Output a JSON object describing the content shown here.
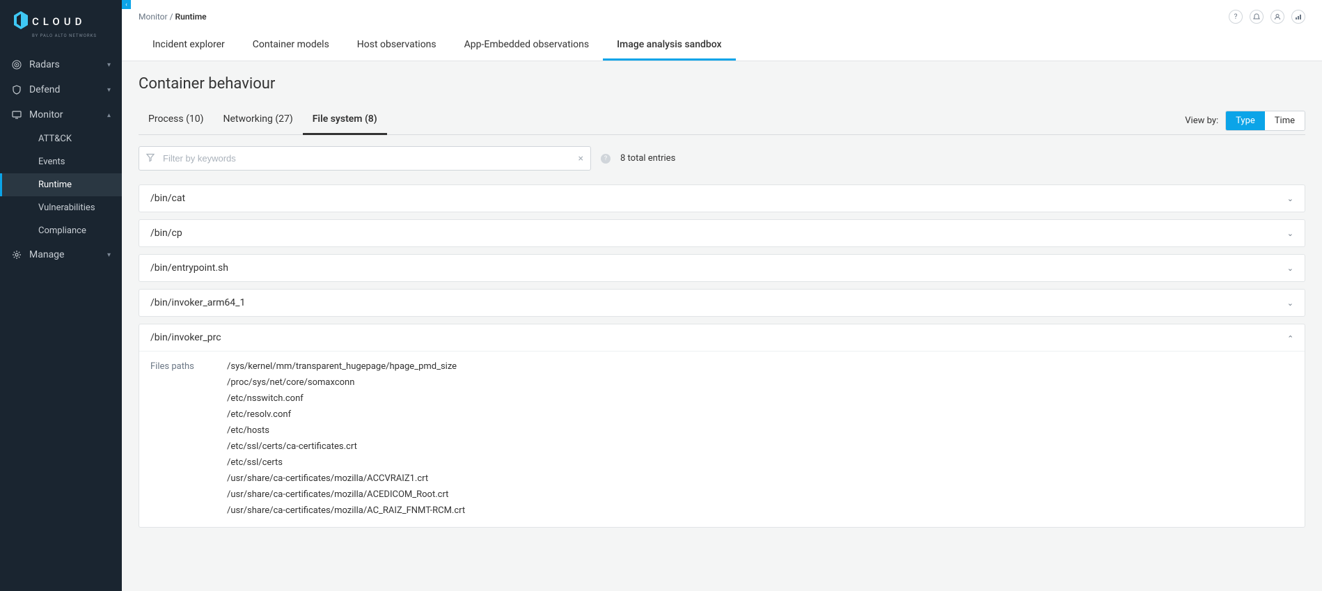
{
  "brand": {
    "name": "CLOUD",
    "sub": "BY PALO ALTO NETWORKS"
  },
  "sidebar": {
    "items": [
      {
        "label": "Radars",
        "icon": "radar"
      },
      {
        "label": "Defend",
        "icon": "shield"
      },
      {
        "label": "Monitor",
        "icon": "monitor",
        "expanded": true
      },
      {
        "label": "Manage",
        "icon": "gear"
      }
    ],
    "monitor_sub": [
      {
        "label": "ATT&CK"
      },
      {
        "label": "Events"
      },
      {
        "label": "Runtime",
        "active": true
      },
      {
        "label": "Vulnerabilities"
      },
      {
        "label": "Compliance"
      }
    ]
  },
  "breadcrumb": {
    "a": "Monitor",
    "sep": "/",
    "b": "Runtime"
  },
  "top_tabs": [
    {
      "label": "Incident explorer"
    },
    {
      "label": "Container models"
    },
    {
      "label": "Host observations"
    },
    {
      "label": "App-Embedded observations"
    },
    {
      "label": "Image analysis sandbox",
      "active": true
    }
  ],
  "page_title": "Container behaviour",
  "subtabs": [
    {
      "label": "Process (10)"
    },
    {
      "label": "Networking (27)"
    },
    {
      "label": "File system (8)",
      "active": true
    }
  ],
  "viewby": {
    "label": "View by:",
    "options": [
      "Type",
      "Time"
    ],
    "active": "Type"
  },
  "filter": {
    "placeholder": "Filter by keywords",
    "total": "8 total entries"
  },
  "entries": [
    {
      "name": "/bin/cat"
    },
    {
      "name": "/bin/cp"
    },
    {
      "name": "/bin/entrypoint.sh"
    },
    {
      "name": "/bin/invoker_arm64_1"
    },
    {
      "name": "/bin/invoker_prc",
      "open": true,
      "files_label": "Files paths",
      "paths": [
        "/sys/kernel/mm/transparent_hugepage/hpage_pmd_size",
        "/proc/sys/net/core/somaxconn",
        "/etc/nsswitch.conf",
        "/etc/resolv.conf",
        "/etc/hosts",
        "/etc/ssl/certs/ca-certificates.crt",
        "/etc/ssl/certs",
        "/usr/share/ca-certificates/mozilla/ACCVRAIZ1.crt",
        "/usr/share/ca-certificates/mozilla/ACEDICOM_Root.crt",
        "/usr/share/ca-certificates/mozilla/AC_RAIZ_FNMT-RCM.crt"
      ]
    }
  ]
}
